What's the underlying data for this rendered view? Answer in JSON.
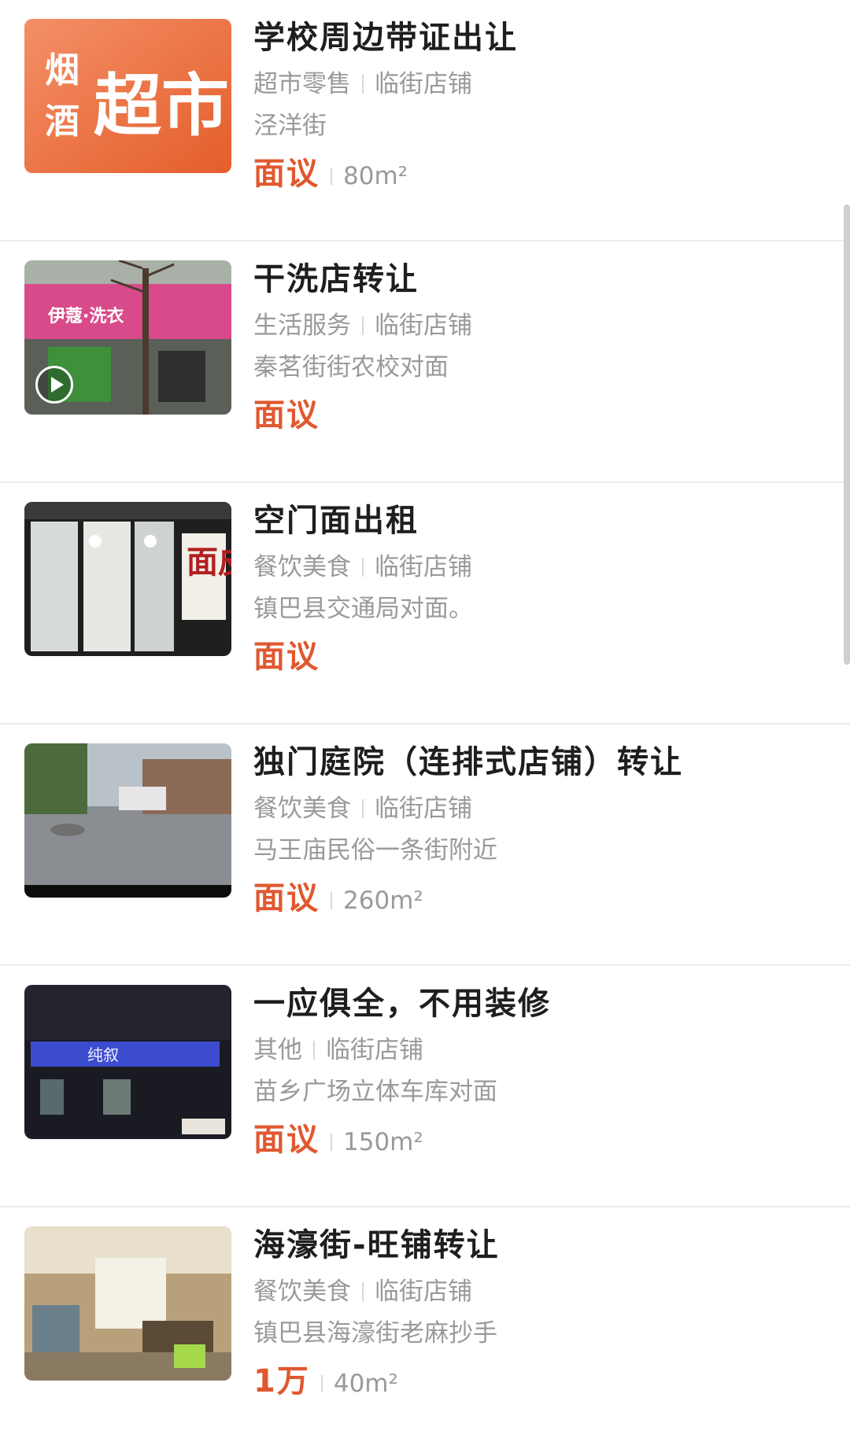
{
  "listings": [
    {
      "title": "学校周边带证出让",
      "category": "超市零售",
      "shop_type": "临街店铺",
      "address": "泾洋街",
      "price": "面议",
      "area": "80m²",
      "thumb": {
        "kind": "supermarket-sign",
        "text_large": "超市",
        "text_small_1": "烟",
        "text_small_2": "酒",
        "color": "#f06a34"
      }
    },
    {
      "title": "干洗店转让",
      "category": "生活服务",
      "shop_type": "临街店铺",
      "address": "秦茗街街农校对面",
      "price": "面议",
      "area": "",
      "thumb": {
        "kind": "laundry-storefront",
        "sign_text": "伊蔻·洗衣",
        "color": "#d84a8a",
        "has_video": true
      }
    },
    {
      "title": "空门面出租",
      "category": "餐饮美食",
      "shop_type": "临街店铺",
      "address": "镇巴县交通局对面。",
      "price": "面议",
      "area": "",
      "thumb": {
        "kind": "noodle-shop-window",
        "sign_text": "面皮",
        "color": "#2a2a2a"
      }
    },
    {
      "title": "独门庭院（连排式店铺）转让",
      "category": "餐饮美食",
      "shop_type": "临街店铺",
      "address": "马王庙民俗一条街附近",
      "price": "面议",
      "area": "260m²",
      "thumb": {
        "kind": "courtyard-street",
        "color": "#8a8e92"
      }
    },
    {
      "title": "一应俱全，不用装修",
      "category": "其他",
      "shop_type": "临街店铺",
      "address": "苗乡广场立体车库对面",
      "price": "面议",
      "area": "150m²",
      "thumb": {
        "kind": "night-storefront",
        "sign_text": "纯叙",
        "color": "#3b4ccf"
      }
    },
    {
      "title": "海濠街-旺铺转让",
      "category": "餐饮美食",
      "shop_type": "临街店铺",
      "address": "镇巴县海濠街老麻抄手",
      "price": "1万",
      "area": "40m²",
      "thumb": {
        "kind": "restaurant-interior",
        "color": "#b8a07a"
      }
    }
  ],
  "colors": {
    "title": "#1e1e1e",
    "meta": "#9a9a9a",
    "price": "#e0582f",
    "divider": "#ececec"
  }
}
